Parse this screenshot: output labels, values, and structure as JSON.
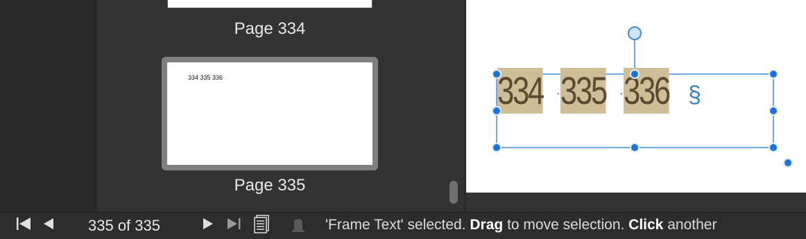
{
  "thumbnails": {
    "prev_label": "Page 334",
    "current_label": "Page 335",
    "current_preview_text": "334 335 336"
  },
  "canvas": {
    "frame_text": [
      "334",
      "335",
      "336"
    ],
    "pilcrow": "§"
  },
  "statusbar": {
    "page_counter": "335 of 335",
    "msg_part1": "'Frame Text' selected. ",
    "msg_bold1": "Drag",
    "msg_part2": " to move selection. ",
    "msg_bold2": "Click",
    "msg_part3": " another"
  },
  "icons": {
    "first": "first-page-icon",
    "prev": "previous-page-icon",
    "next": "next-page-icon",
    "last": "last-page-icon",
    "page_view": "page-view-icon",
    "record": "record-icon"
  }
}
